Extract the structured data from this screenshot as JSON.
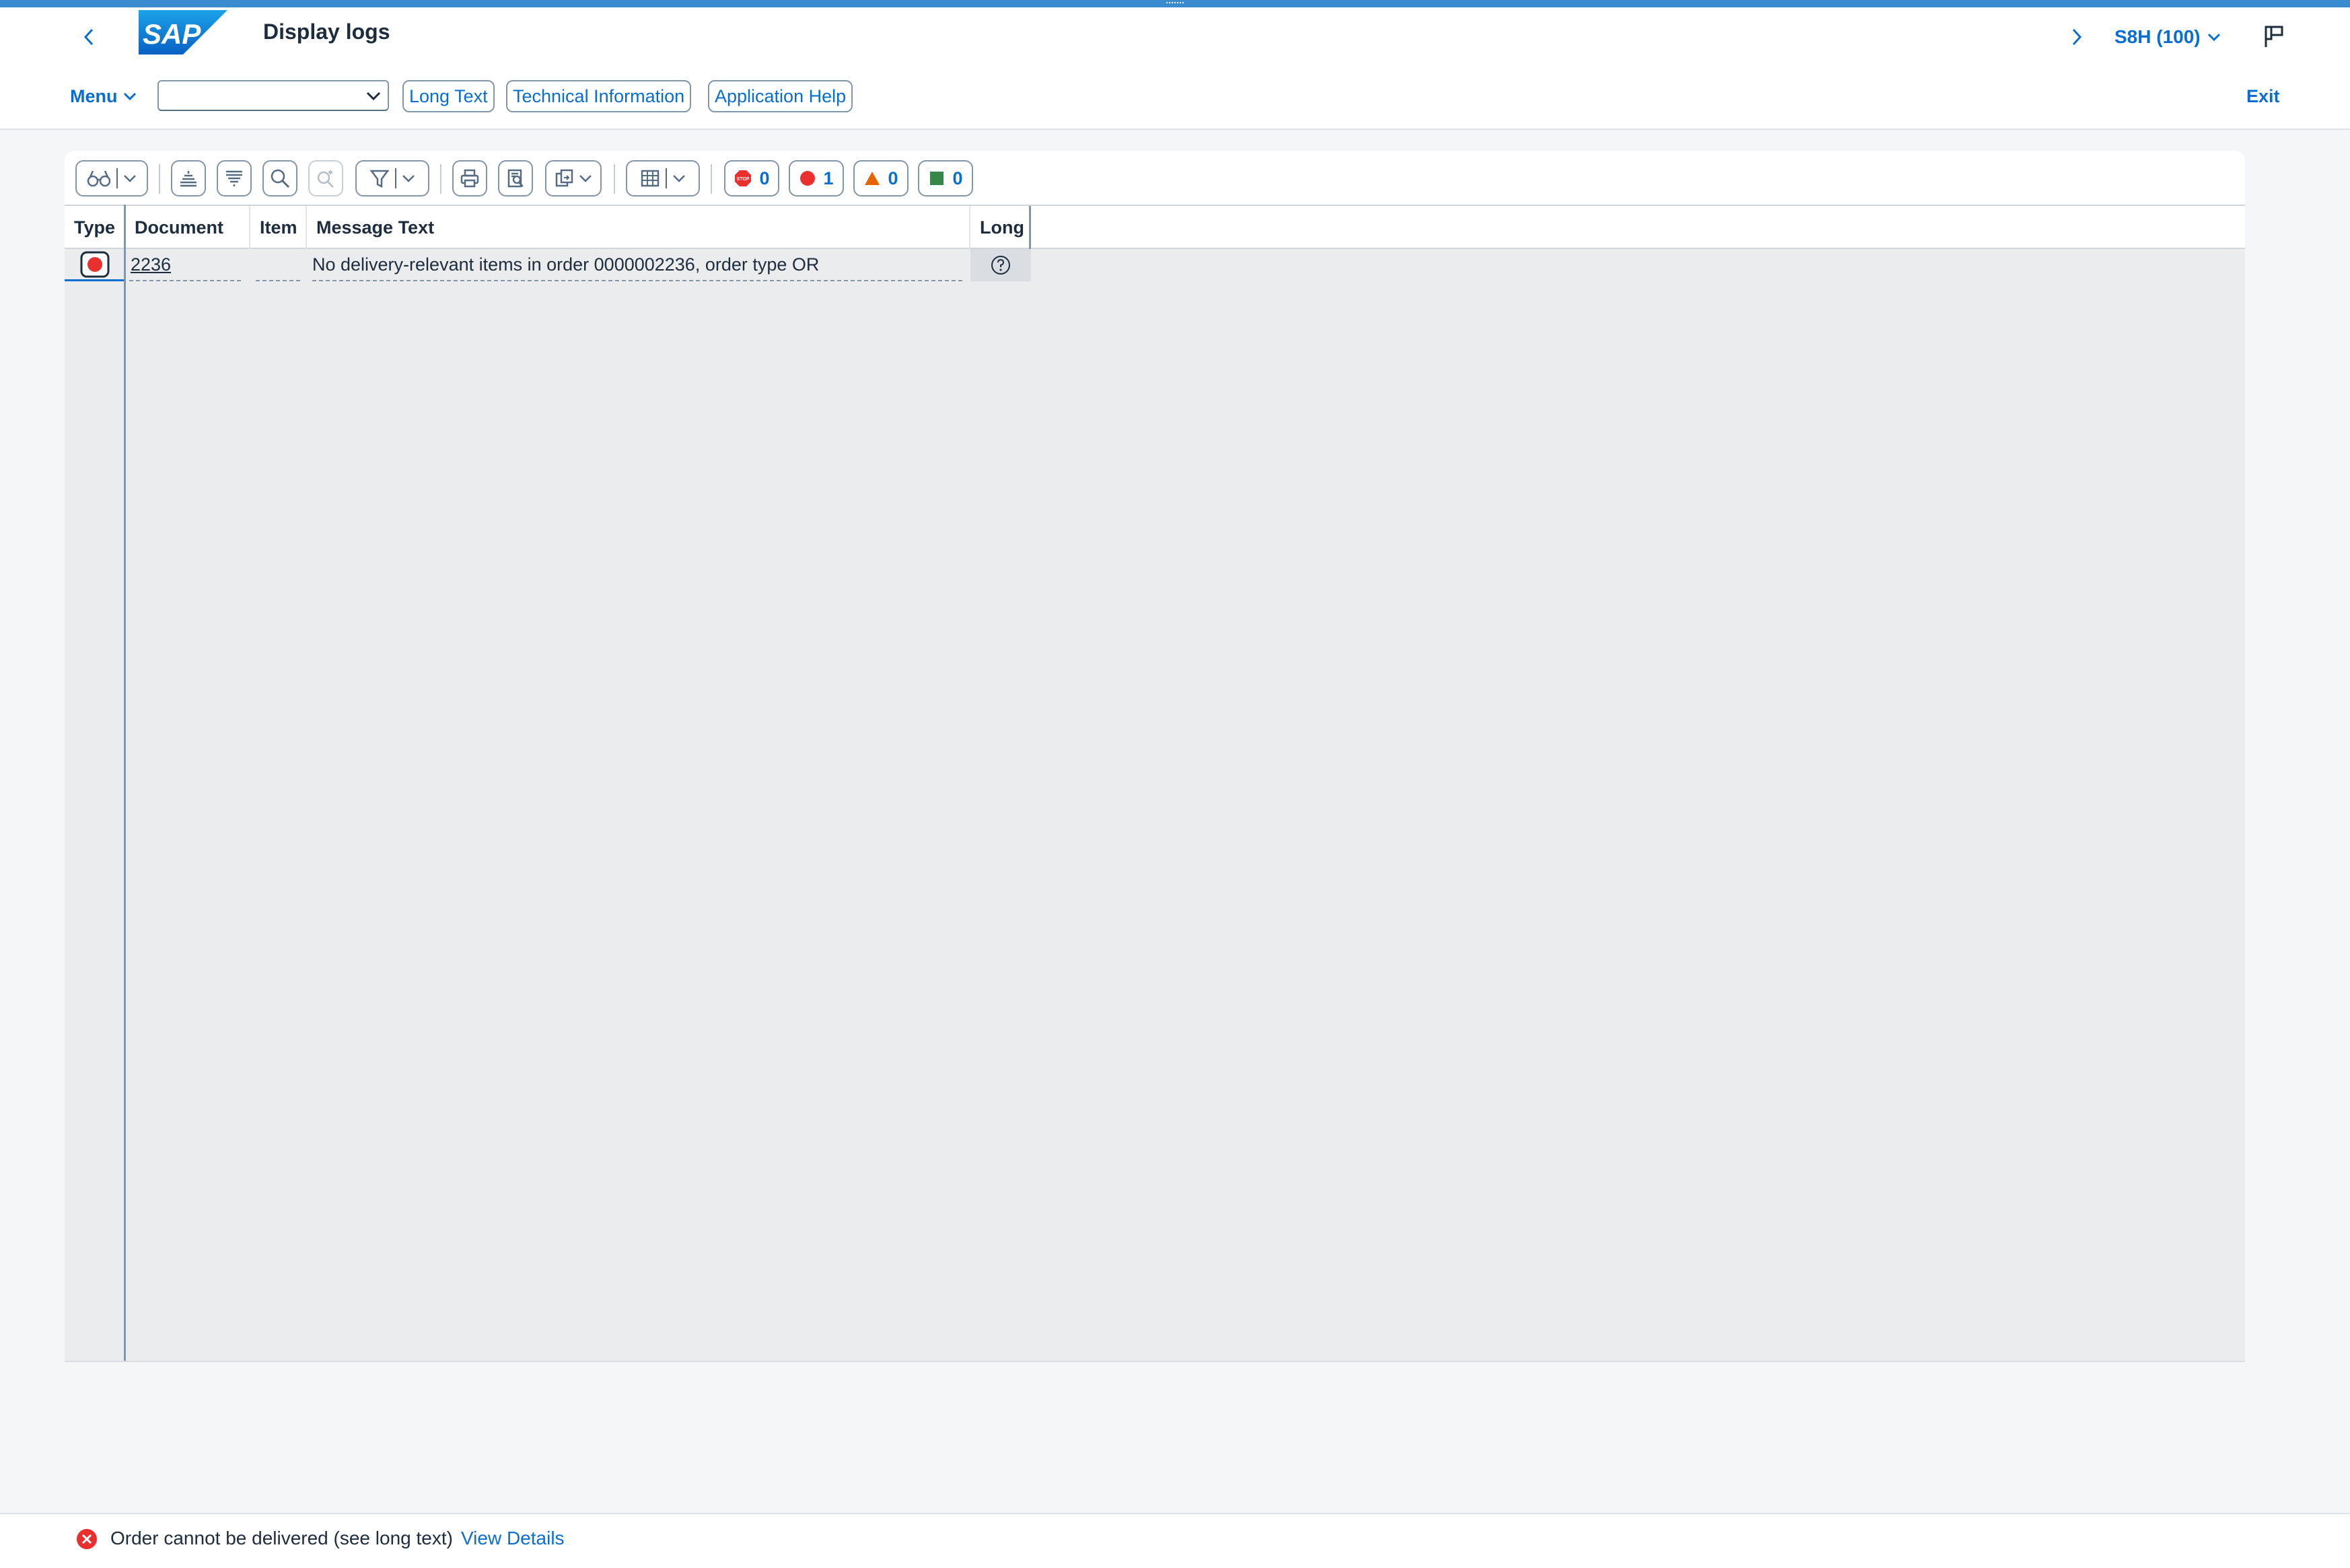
{
  "shell": {
    "title": "Display logs",
    "system": "S8H (100)",
    "logo_text": "SAP"
  },
  "appbar": {
    "menu_label": "Menu",
    "command_value": "",
    "buttons": [
      "Long Text",
      "Technical Information",
      "Application Help"
    ],
    "exit_label": "Exit"
  },
  "toolbar": {
    "counters": {
      "stop": "0",
      "error": "1",
      "warning": "0",
      "success": "0"
    }
  },
  "table": {
    "columns": [
      "Type",
      "Document",
      "Item",
      "Message Text",
      "Long"
    ],
    "rows": [
      {
        "type_icon": "error-icon",
        "document": "2236",
        "item": "",
        "message": "No delivery-relevant items in order 0000002236, order type OR",
        "long_icon": "help-icon"
      }
    ]
  },
  "message_bar": {
    "text": "Order cannot be delivered (see long text)",
    "link": "View Details"
  },
  "colors": {
    "brand_blue": "#0a6ed1",
    "error_red": "#e9302f",
    "warning_orange": "#e76500",
    "success_green": "#36884a"
  }
}
